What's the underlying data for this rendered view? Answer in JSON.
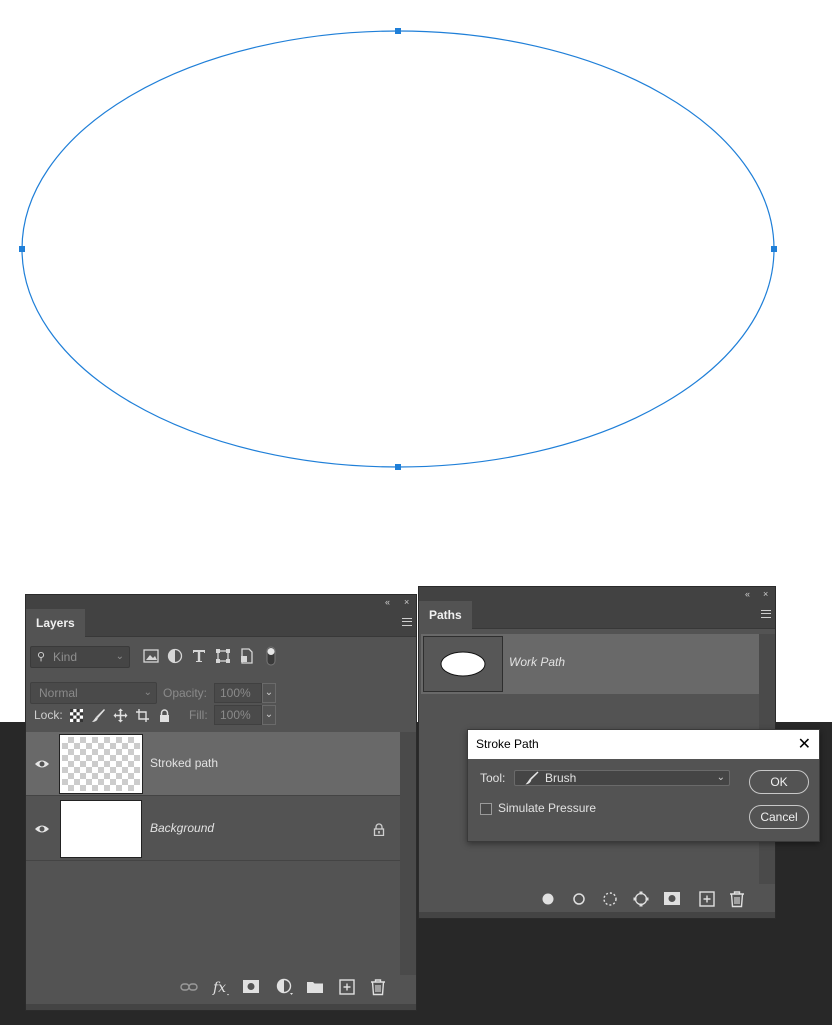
{
  "layers_panel": {
    "tab_label": "Layers",
    "collapse_glyph": "«",
    "close_glyph": "×",
    "kind_placeholder": "Kind",
    "blend_mode": "Normal",
    "opacity_label": "Opacity:",
    "opacity_value": "100%",
    "lock_label": "Lock:",
    "fill_label": "Fill:",
    "fill_value": "100%",
    "layers": [
      {
        "name": "Stroked path",
        "selected": true,
        "visible": true,
        "thumbnail": "transparent"
      },
      {
        "name": "Background",
        "selected": false,
        "visible": true,
        "thumbnail": "white",
        "locked": true
      }
    ],
    "filter_icons": [
      "image-filter-icon",
      "adjustment-filter-icon",
      "type-filter-icon",
      "shape-filter-icon",
      "smart-object-filter-icon",
      "filter-toggle-icon"
    ],
    "lock_icons": [
      "lock-transparent-icon",
      "lock-image-icon",
      "lock-position-icon",
      "lock-artboard-icon",
      "lock-all-icon"
    ],
    "footer_icons": [
      "link-layers-icon",
      "fx-icon",
      "add-mask-icon",
      "new-adjustment-icon",
      "new-group-icon",
      "new-layer-icon",
      "delete-layer-icon"
    ]
  },
  "paths_panel": {
    "tab_label": "Paths",
    "collapse_glyph": "«",
    "close_glyph": "×",
    "paths": [
      {
        "name": "Work Path",
        "selected": true
      }
    ],
    "footer_icons": [
      "fill-path-icon",
      "stroke-path-icon",
      "load-selection-icon",
      "make-work-path-icon",
      "add-mask-icon",
      "new-path-icon",
      "delete-path-icon"
    ]
  },
  "stroke_dialog": {
    "title": "Stroke Path",
    "close_glyph": "✕",
    "tool_label": "Tool:",
    "tool_value": "Brush",
    "simulate_pressure_label": "Simulate Pressure",
    "simulate_pressure_checked": false,
    "ok_label": "OK",
    "cancel_label": "Cancel"
  },
  "colors": {
    "path_stroke": "#1f7fd8",
    "panel_bg": "#535353",
    "panel_header": "#424242",
    "selected_row": "#696969",
    "workspace_dark": "#282828"
  }
}
